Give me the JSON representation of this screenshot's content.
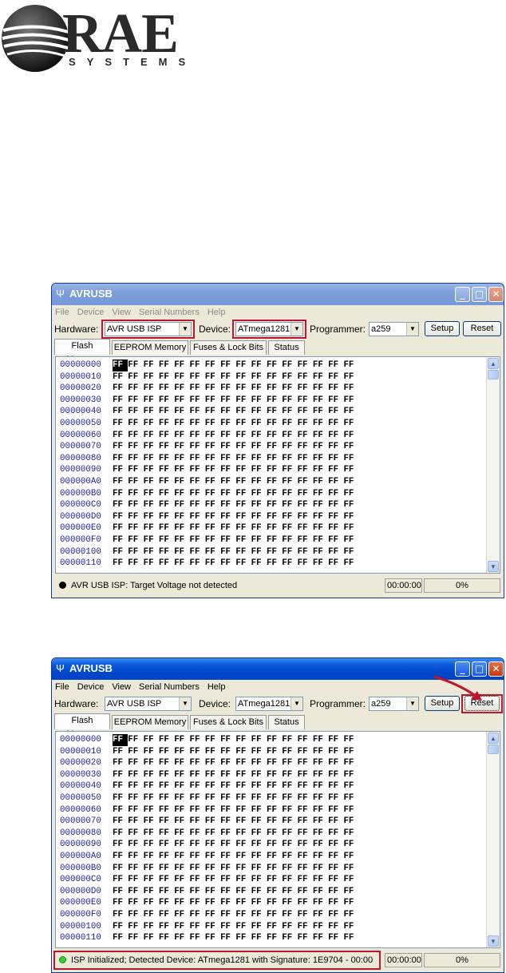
{
  "logo": {
    "word": "RAE",
    "sub": "SYSTEMS"
  },
  "windows": [
    {
      "title": "AVRUSB",
      "menu": [
        "File",
        "Device",
        "View",
        "Serial Numbers",
        "Help"
      ],
      "labels": {
        "hardware": "Hardware:",
        "device": "Device:",
        "programmer": "Programmer:"
      },
      "hardware_value": "AVR USB ISP",
      "device_value": "ATmega1281",
      "programmer_value": "a259",
      "setup_label": "Setup",
      "reset_label": "Reset",
      "tabs": [
        "Flash Memory",
        "EEPROM Memory",
        "Fuses & Lock Bits",
        "Status"
      ],
      "status_text": "AVR USB ISP: Target Voltage not detected",
      "status_led": "#000000",
      "time": "00:00:00",
      "progress": "0%"
    },
    {
      "title": "AVRUSB",
      "menu": [
        "File",
        "Device",
        "View",
        "Serial Numbers",
        "Help"
      ],
      "labels": {
        "hardware": "Hardware:",
        "device": "Device:",
        "programmer": "Programmer:"
      },
      "hardware_value": "AVR USB ISP",
      "device_value": "ATmega1281",
      "programmer_value": "a259",
      "setup_label": "Setup",
      "reset_label": "Reset",
      "tabs": [
        "Flash Memory",
        "EEPROM Memory",
        "Fuses & Lock Bits",
        "Status"
      ],
      "status_text": "ISP Initialized; Detected Device: ATmega1281 with Signature: 1E9704 - 00:00",
      "status_led": "#2ed02e",
      "time": "00:00:00",
      "progress": "0%"
    }
  ],
  "hex": {
    "addresses": [
      "00000000",
      "00000010",
      "00000020",
      "00000030",
      "00000040",
      "00000050",
      "00000060",
      "00000070",
      "00000080",
      "00000090",
      "000000A0",
      "000000B0",
      "000000C0",
      "000000D0",
      "000000E0",
      "000000F0",
      "00000100",
      "00000110"
    ],
    "byte_value": "FF",
    "bytes_per_row": 16
  },
  "colors": {
    "highlight": "#c0162c",
    "titlebar": "#0a5bdb",
    "address": "#1c1ca0"
  }
}
